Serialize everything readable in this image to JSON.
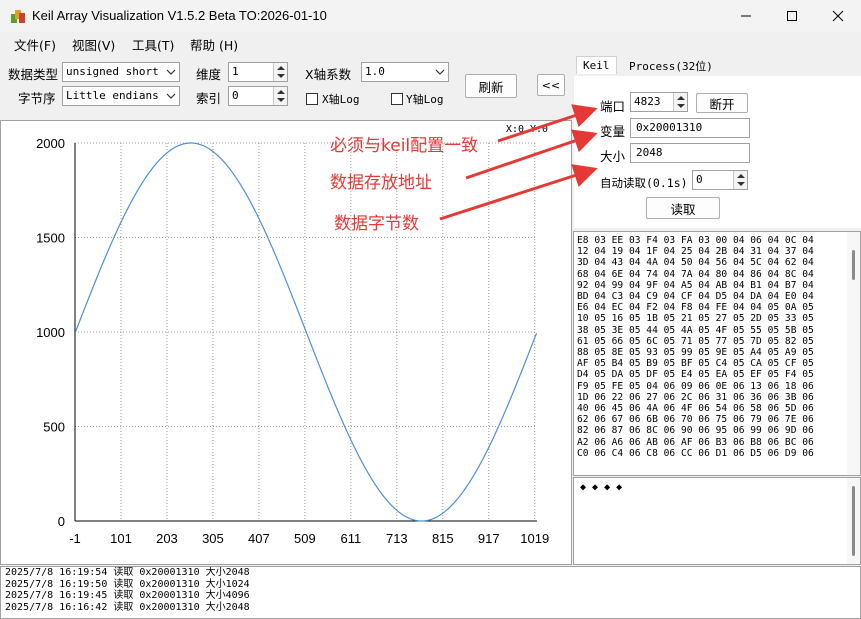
{
  "window": {
    "title": "Keil Array Visualization V1.5.2 Beta TO:2026-01-10"
  },
  "menu": [
    "文件(F)",
    "视图(V)",
    "工具(T)",
    "帮助 (H)"
  ],
  "toolbar": {
    "data_type_label": "数据类型",
    "data_type_value": "unsigned short",
    "byte_order_label": "字节序",
    "byte_order_value": "Little endians",
    "dimension_label": "维度",
    "dimension_value": "1",
    "index_label": "索引",
    "index_value": "0",
    "x_factor_label": "X轴系数",
    "x_factor_value": "1.0",
    "xlog_label": "X轴Log",
    "ylog_label": "Y轴Log",
    "xlog_checked": false,
    "ylog_checked": false,
    "refresh_label": "刷新",
    "collapse_label": "<<"
  },
  "plot": {
    "coord_readout": "X:0 Y:0"
  },
  "chart_data": {
    "type": "line",
    "xlim": [
      -1,
      1024
    ],
    "ylim": [
      0,
      2000
    ],
    "x_ticks": [
      "-1",
      "101",
      "203",
      "305",
      "407",
      "509",
      "611",
      "713",
      "815",
      "917",
      "1019"
    ],
    "y_ticks": [
      "0",
      "500",
      "1000",
      "1500",
      "2000"
    ],
    "grid": true,
    "series": [
      {
        "color": "#4a90d9",
        "samples": 1024,
        "formula": "1000 + 1000*sin(2*pi*i/1024)",
        "x": [
          0,
          128,
          256,
          384,
          512,
          640,
          768,
          896,
          1023
        ],
        "y": [
          1000,
          1707,
          2000,
          1707,
          1000,
          293,
          0,
          293,
          994
        ]
      }
    ]
  },
  "panel": {
    "tabs": [
      "Keil",
      "Process(32位)"
    ],
    "active_tab": "Keil",
    "port_label": "端口",
    "port_value": "4823",
    "disconnect_label": "断开",
    "variable_label": "变量",
    "variable_value": "0x20001310",
    "size_label": "大小",
    "size_value": "2048",
    "auto_read_label": "自动读取(0.1s)",
    "auto_read_value": "0",
    "read_label": "读取"
  },
  "hex_lines": [
    "E8 03 EE 03 F4 03 FA 03 00 04 06 04 0C 04",
    "12 04 19 04 1F 04 25 04 2B 04 31 04 37 04",
    "3D 04 43 04 4A 04 50 04 56 04 5C 04 62 04",
    "68 04 6E 04 74 04 7A 04 80 04 86 04 8C 04",
    "92 04 99 04 9F 04 A5 04 AB 04 B1 04 B7 04",
    "BD 04 C3 04 C9 04 CF 04 D5 04 DA 04 E0 04",
    "E6 04 EC 04 F2 04 F8 04 FE 04 04 05 0A 05",
    "10 05 16 05 1B 05 21 05 27 05 2D 05 33 05",
    "38 05 3E 05 44 05 4A 05 4F 05 55 05 5B 05",
    "61 05 66 05 6C 05 71 05 77 05 7D 05 82 05",
    "88 05 8E 05 93 05 99 05 9E 05 A4 05 A9 05",
    "AF 05 B4 05 B9 05 BF 05 C4 05 CA 05 CF 05",
    "D4 05 DA 05 DF 05 E4 05 EA 05 EF 05 F4 05",
    "F9 05 FE 05 04 06 09 06 0E 06 13 06 18 06",
    "1D 06 22 06 27 06 2C 06 31 06 36 06 3B 06",
    "40 06 45 06 4A 06 4F 06 54 06 58 06 5D 06",
    "62 06 67 06 6B 06 70 06 75 06 79 06 7E 06",
    "82 06 87 06 8C 06 90 06 95 06 99 06 9D 06",
    "A2 06 A6 06 AB 06 AF 06 B3 06 B8 06 BC 06",
    "C0 06 C4 06 C8 06 CC 06 D1 06 D5 06 D9 06"
  ],
  "note_text": "◆ ◆ ◆ ◆",
  "log_lines": [
    "2025/7/8 16:19:54 读取 0x20001310 大小2048",
    "2025/7/8 16:19:50 读取 0x20001310 大小1024",
    "2025/7/8 16:19:45 读取 0x20001310 大小4096",
    "2025/7/8 16:16:42 读取 0x20001310 大小2048"
  ],
  "annotations": {
    "port_note": "必须与keil配置一致",
    "variable_note": "数据存放地址",
    "size_note": "数据字节数",
    "color": "#e53935"
  }
}
